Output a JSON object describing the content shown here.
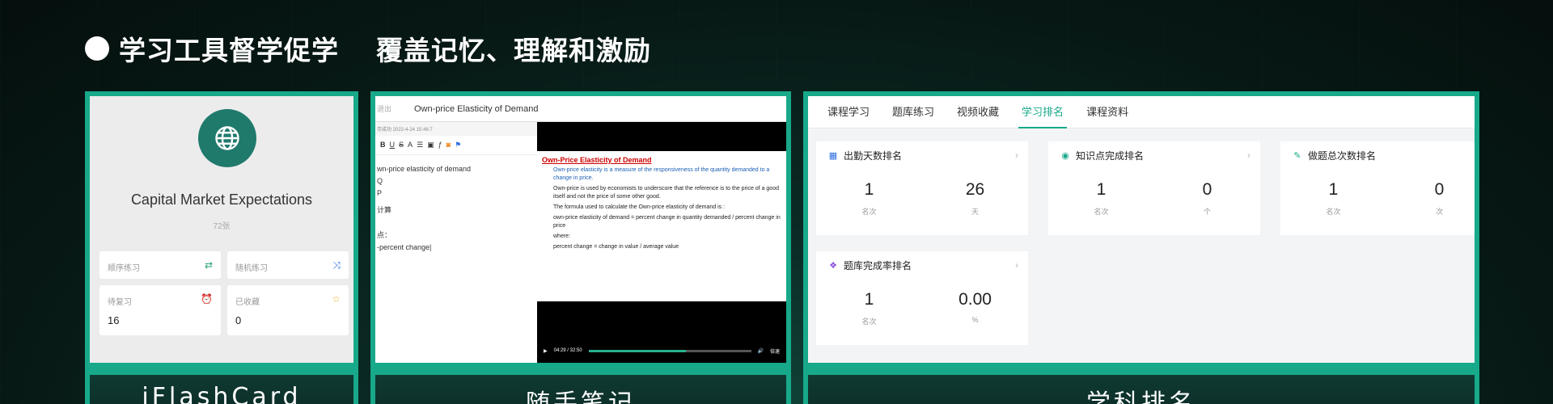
{
  "headline": {
    "part1": "学习工具督学促学",
    "part2": "覆盖记忆、理解和激励"
  },
  "panel1": {
    "deck_title": "Capital Market Expectations",
    "deck_count": "72张",
    "tiles": [
      {
        "label": "顺序练习",
        "icon": "repeat-icon"
      },
      {
        "label": "随机练习",
        "icon": "shuffle-icon"
      },
      {
        "label": "待复习",
        "value": "16",
        "icon": "alarm-icon"
      },
      {
        "label": "已收藏",
        "value": "0",
        "icon": "star-icon"
      }
    ],
    "caption": "iFlashCard"
  },
  "panel2": {
    "back_label": "退出",
    "title": "Own-price Elasticity of Demand",
    "saved_meta": "存成功 2022-4-24 15:46:7",
    "notes": [
      "wn-price elasticity of demand",
      "Q",
      "P",
      "计算",
      "点：",
      "-percent change|"
    ],
    "slide_title": "Own-Price Elasticity of Demand",
    "slide_lines": [
      "Own-price elasticity is a measure of the responsiveness of the quantity demanded to a change in price.",
      "Own-price is used by economists to underscore that the reference is to the price of a good itself and not the price of some other good.",
      "The formula used to calculate the Own-price elasticity of demand is :",
      "own-price elasticity of demand = percent change in quantity demanded / percent change in price",
      "where:",
      "percent change = change in value / average value"
    ],
    "time": "04:29 / 32:50",
    "speed": "倍速",
    "progress": 0.6,
    "caption": "随手笔记"
  },
  "panel3": {
    "tabs": [
      "课程学习",
      "题库练习",
      "视频收藏",
      "学习排名",
      "课程资料"
    ],
    "active_tab": "学习排名",
    "cards": [
      {
        "title": "出勤天数排名",
        "icon": "calendar-icon",
        "v1": "1",
        "u1": "名次",
        "v2": "26",
        "u2": "天"
      },
      {
        "title": "知识点完成排名",
        "icon": "play-circle-icon",
        "v1": "1",
        "u1": "名次",
        "v2": "0",
        "u2": "个"
      },
      {
        "title": "做题总次数排名",
        "icon": "pencil-icon",
        "v1": "1",
        "u1": "名次",
        "v2": "0",
        "u2": "次"
      },
      {
        "title": "题库完成率排名",
        "icon": "cubes-icon",
        "v1": "1",
        "u1": "名次",
        "v2": "0.00",
        "u2": "%"
      }
    ],
    "caption": "学科排名"
  },
  "colors": {
    "accent": "#17a98a",
    "background": "#071915"
  }
}
